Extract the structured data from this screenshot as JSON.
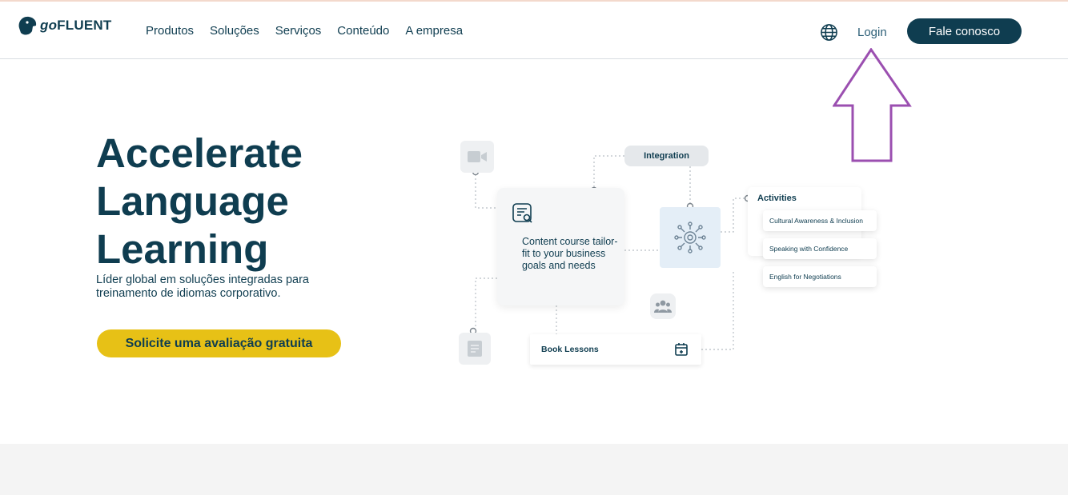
{
  "header": {
    "logo": {
      "prefix": "go",
      "name": "FLUENT"
    },
    "nav": [
      "Produtos",
      "Soluções",
      "Serviços",
      "Conteúdo",
      "A empresa"
    ],
    "login_label": "Login",
    "contact_label": "Fale conosco",
    "icons": {
      "language": "globe-icon"
    }
  },
  "hero": {
    "title_lines": [
      "Accelerate",
      "Language",
      "Learning"
    ],
    "subtitle": "Líder global em soluções integradas para treinamento de idiomas corporativo.",
    "cta_label": "Solicite uma avaliação gratuita"
  },
  "diagram": {
    "integration_label": "Integration",
    "content_card_text": "Content course tailor-fit to your business goals and needs",
    "activities_title": "Activities",
    "activities": [
      "Cultural Awareness & Inclusion",
      "Speaking with Confidence",
      "English for Negotiations"
    ],
    "book_lessons_label": "Book Lessons",
    "icons": [
      "video-icon",
      "document-icon",
      "content-icon",
      "gear-network-icon",
      "group-icon",
      "calendar-icon"
    ]
  },
  "annotation": {
    "type": "up-arrow",
    "color": "#9b4fb0"
  },
  "colors": {
    "brand": "#0f3d50",
    "accent": "#e7c116",
    "annotation": "#9b4fb0"
  }
}
